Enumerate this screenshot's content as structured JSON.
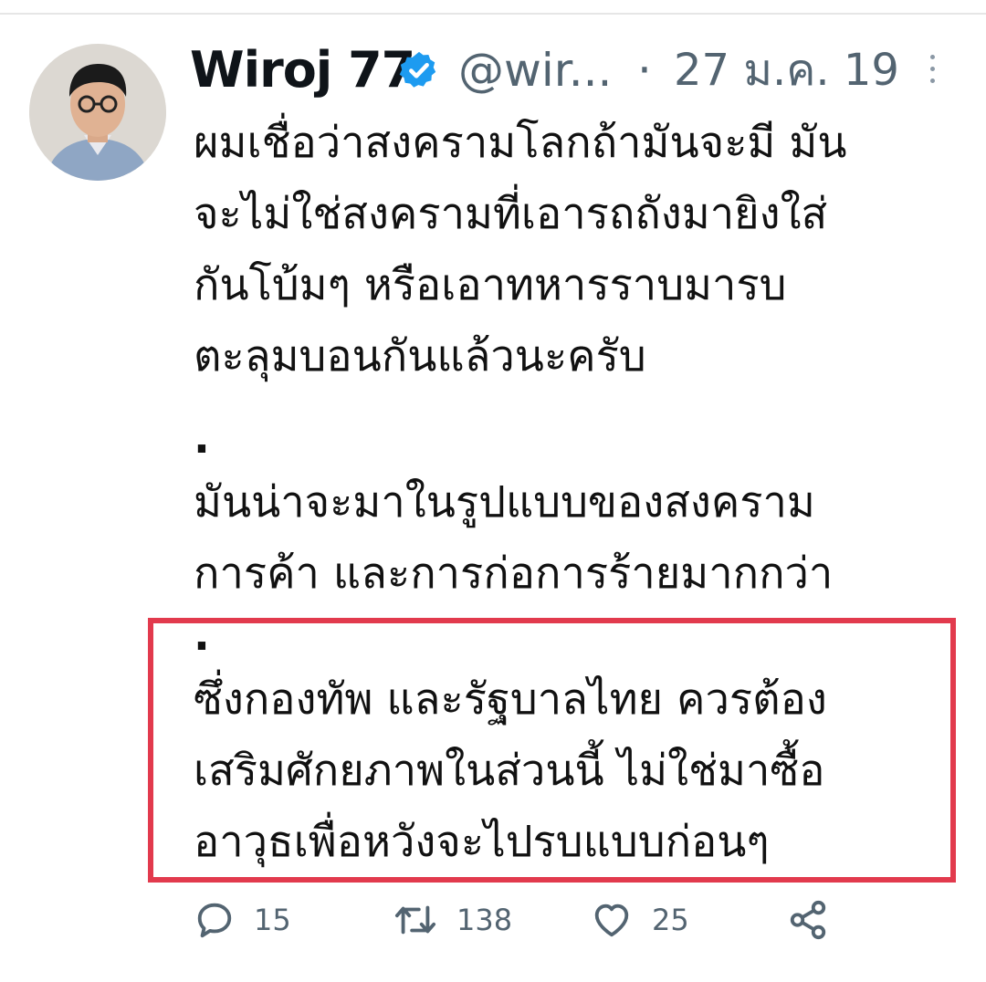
{
  "tweet": {
    "author_name": "Wiroj 77",
    "handle": "@wir...",
    "separator": "·",
    "date": "27 ม.ค. 19",
    "lines": [
      "ผมเชื่อว่าสงครามโลกถ้ามันจะมี มัน",
      "จะไม่ใช่สงครามที่เอารถถังมายิงใส่",
      "กันโบ้มๆ หรือเอาทหารราบมารบ",
      "ตะลุมบอนกันแล้วนะครับ",
      ".",
      "มันน่าจะมาในรูปแบบของสงคราม",
      "การค้า และการก่อการร้ายมากกว่า",
      ".",
      "ซึ่งกองทัพ และรัฐบาลไทย ควรต้อง",
      "เสริมศักยภาพในส่วนนี้ ไม่ใช่มาซื้อ",
      "อาวุธเพื่อหวังจะไปรบแบบก่อนๆ"
    ],
    "replies": "15",
    "retweets": "138",
    "likes": "25"
  },
  "icons": {
    "verified": "verified-badge-icon",
    "more": "more-vertical-icon",
    "reply": "reply-icon",
    "retweet": "retweet-icon",
    "like": "heart-icon",
    "share": "share-icon"
  },
  "colors": {
    "highlight_border": "#e23a4d",
    "verified_blue": "#1d9bf0",
    "muted_text": "#536471"
  }
}
